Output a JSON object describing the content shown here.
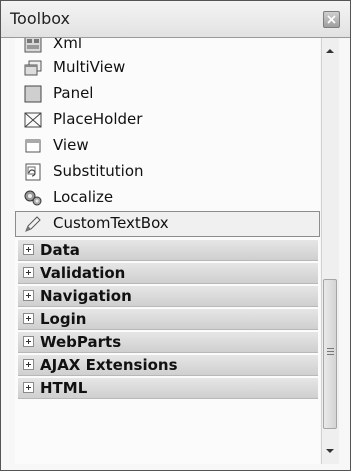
{
  "toolbox": {
    "title": "Toolbox",
    "controls": [
      {
        "label": "Xml",
        "icon": "xml-icon"
      },
      {
        "label": "MultiView",
        "icon": "multiview-icon"
      },
      {
        "label": "Panel",
        "icon": "panel-icon"
      },
      {
        "label": "PlaceHolder",
        "icon": "placeholder-icon"
      },
      {
        "label": "View",
        "icon": "view-icon"
      },
      {
        "label": "Substitution",
        "icon": "substitution-icon"
      },
      {
        "label": "Localize",
        "icon": "localize-icon"
      },
      {
        "label": "CustomTextBox",
        "icon": "customtextbox-icon",
        "selected": true
      }
    ],
    "categories": [
      {
        "label": "Data"
      },
      {
        "label": "Validation"
      },
      {
        "label": "Navigation"
      },
      {
        "label": "Login"
      },
      {
        "label": "WebParts"
      },
      {
        "label": "AJAX Extensions"
      },
      {
        "label": "HTML"
      }
    ]
  }
}
